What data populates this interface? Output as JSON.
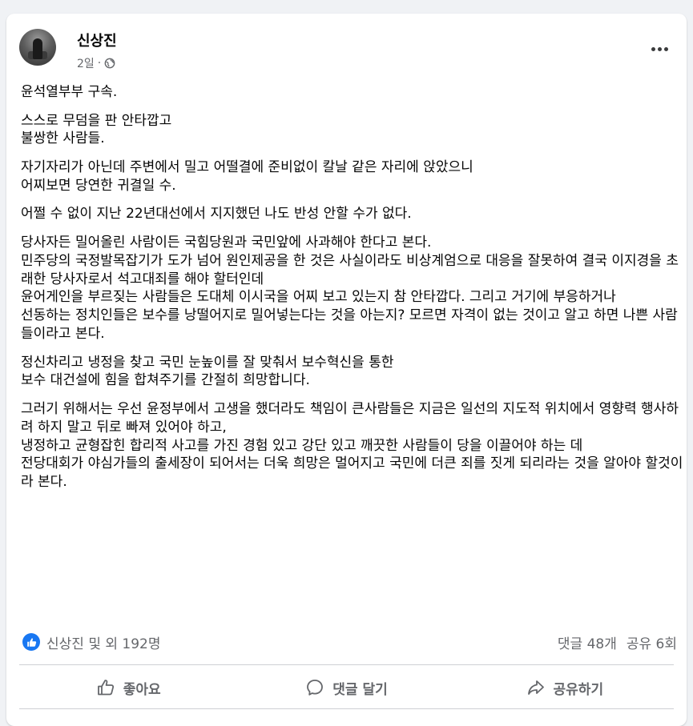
{
  "post": {
    "author": "신상진",
    "time": "2일",
    "separator": "·",
    "paragraphs": [
      "윤석열부부 구속.",
      "스스로 무덤을 판 안타깝고\n불쌍한 사람들.",
      "자기자리가 아닌데 주변에서 밀고 어떨결에 준비없이 칼날 같은 자리에 앉았으니\n어찌보면 당연한 귀결일 수.",
      "어쩔 수 없이 지난 22년대선에서 지지했던 나도 반성 안할 수가 없다.",
      "당사자든 밀어올린 사람이든 국힘당원과 국민앞에 사과해야 한다고 본다.\n민주당의 국정발목잡기가 도가 넘어  원인제공을 한 것은 사실이라도 비상계엄으로 대응을 잘못하여 결국 이지경을 초래한 당사자로서 석고대죄를 해야 할터인데\n윤어게인을 부르짖는 사람들은 도대체 이시국을 어찌 보고 있는지 참 안타깝다. 그리고 거기에 부응하거나\n선동하는 정치인들은 보수를 낭떨어지로 밀어넣는다는 것을 아는지? 모르면 자격이 없는 것이고 알고 하면 나쁜 사람들이라고 본다.",
      "정신차리고 냉정을 찾고 국민 눈높이를 잘 맞춰서 보수혁신을 통한\n보수 대건설에 힘을 합쳐주기를 간절히 희망합니다.",
      "그러기 위해서는 우선 윤정부에서 고생을 했더라도 책임이 큰사람들은 지금은 일선의 지도적 위치에서 영향력 행사하려 하지 말고 뒤로 빠져 있어야 하고,\n냉정하고 균형잡힌 합리적 사고를 가진 경험 있고 강단 있고 깨끗한 사람들이 당을 이끌어야 하는 데\n전당대회가 야심가들의 출세장이 되어서는 더욱 희망은 멀어지고 국민에 더큰 죄를 짓게 되리라는 것을 알아야 할것이라 본다."
    ]
  },
  "stats": {
    "reactions": "신상진 및 외 192명",
    "comments": "댓글 48개",
    "shares": "공유 6회"
  },
  "actions": {
    "like": "좋아요",
    "comment": "댓글 달기",
    "share": "공유하기"
  },
  "colors": {
    "accent": "#1877f2",
    "secondary_text": "#65676b",
    "background": "#f0f2f5"
  },
  "icons": {
    "privacy": "globe-icon",
    "menu": "more-options-icon",
    "reaction": "like-reaction-icon",
    "like": "thumbs-up-icon",
    "comment": "comment-bubble-icon",
    "share": "share-arrow-icon"
  }
}
